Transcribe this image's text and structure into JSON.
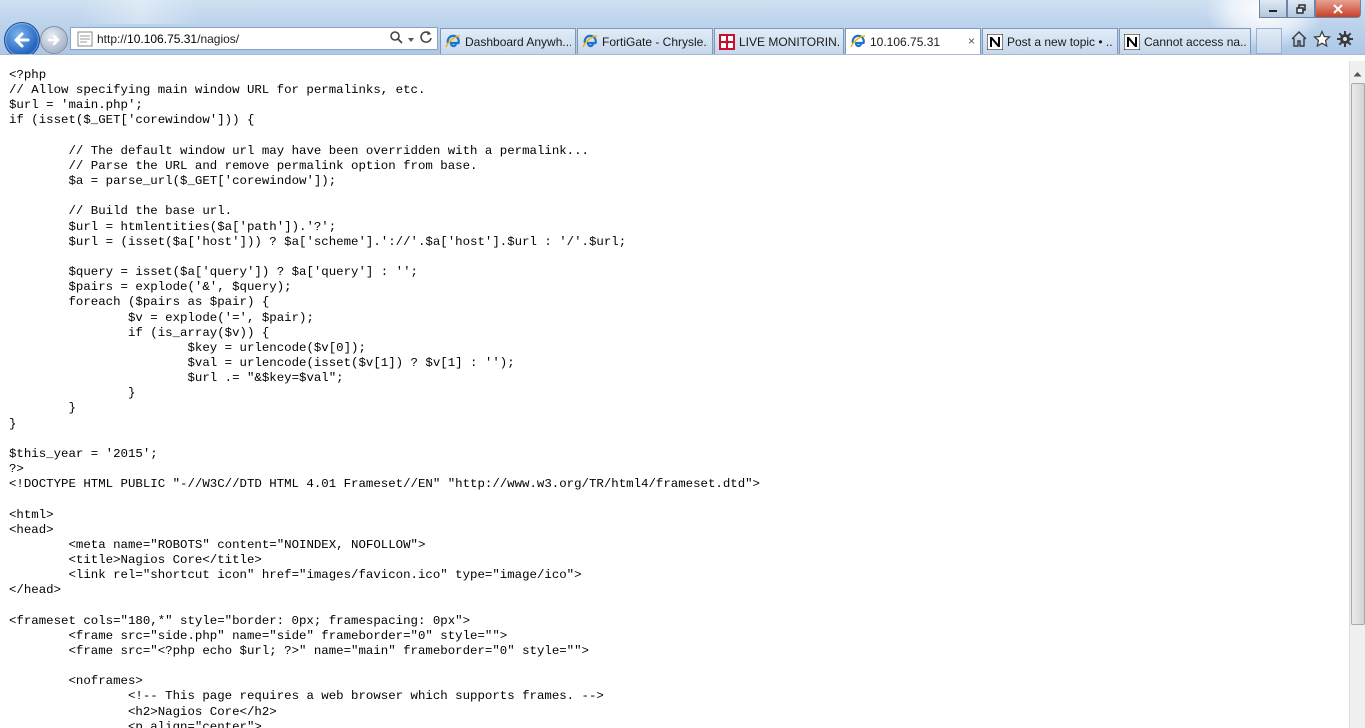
{
  "browser": {
    "address_url_prefix": "http://",
    "address_url_host": "10.106.75.31",
    "address_url_path": "/nagios/",
    "tabs": [
      {
        "label": "Dashboard Anywh...",
        "icon": "ie-icon",
        "active": false,
        "width": 136
      },
      {
        "label": "FortiGate - Chrysle...",
        "icon": "ie-icon",
        "active": false,
        "width": 136
      },
      {
        "label": "LIVE MONITORIN...",
        "icon": "fortinet-icon",
        "active": false,
        "width": 130
      },
      {
        "label": "10.106.75.31",
        "icon": "ie-icon",
        "active": true,
        "close": "×",
        "width": 136
      },
      {
        "label": "Post a new topic • ...",
        "icon": "nagios-n-icon",
        "active": false,
        "width": 136
      },
      {
        "label": "Cannot access na...",
        "icon": "nagios-n-icon",
        "active": false,
        "width": 132
      }
    ],
    "window_buttons": [
      "minimize",
      "restore",
      "close"
    ],
    "accent_colors": {
      "back_button": "#1c5fbd",
      "chrome_top": "#cfe0f1",
      "fortinet": "#c8102e"
    }
  },
  "page": {
    "source_lines": [
      "<?php",
      "// Allow specifying main window URL for permalinks, etc.",
      "$url = 'main.php';",
      "if (isset($_GET['corewindow'])) {",
      "",
      "\t// The default window url may have been overridden with a permalink...",
      "\t// Parse the URL and remove permalink option from base.",
      "\t$a = parse_url($_GET['corewindow']);",
      "",
      "\t// Build the base url.",
      "\t$url = htmlentities($a['path']).'?';",
      "\t$url = (isset($a['host'])) ? $a['scheme'].'://'.$a['host'].$url : '/'.$url;",
      "",
      "\t$query = isset($a['query']) ? $a['query'] : '';",
      "\t$pairs = explode('&', $query);",
      "\tforeach ($pairs as $pair) {",
      "\t\t$v = explode('=', $pair);",
      "\t\tif (is_array($v)) {",
      "\t\t\t$key = urlencode($v[0]);",
      "\t\t\t$val = urlencode(isset($v[1]) ? $v[1] : '');",
      "\t\t\t$url .= \"&$key=$val\";",
      "\t\t}",
      "\t}",
      "}",
      "",
      "$this_year = '2015';",
      "?>",
      "<!DOCTYPE HTML PUBLIC \"-//W3C//DTD HTML 4.01 Frameset//EN\" \"http://www.w3.org/TR/html4/frameset.dtd\">",
      "",
      "<html>",
      "<head>",
      "\t<meta name=\"ROBOTS\" content=\"NOINDEX, NOFOLLOW\">",
      "\t<title>Nagios Core</title>",
      "\t<link rel=\"shortcut icon\" href=\"images/favicon.ico\" type=\"image/ico\">",
      "</head>",
      "",
      "<frameset cols=\"180,*\" style=\"border: 0px; framespacing: 0px\">",
      "\t<frame src=\"side.php\" name=\"side\" frameborder=\"0\" style=\"\">",
      "\t<frame src=\"<?php echo $url; ?>\" name=\"main\" frameborder=\"0\" style=\"\">",
      "",
      "\t<noframes>",
      "\t\t<!-- This page requires a web browser which supports frames. -->",
      "\t\t<h2>Nagios Core</h2>",
      "\t\t<p align=\"center\">"
    ]
  }
}
